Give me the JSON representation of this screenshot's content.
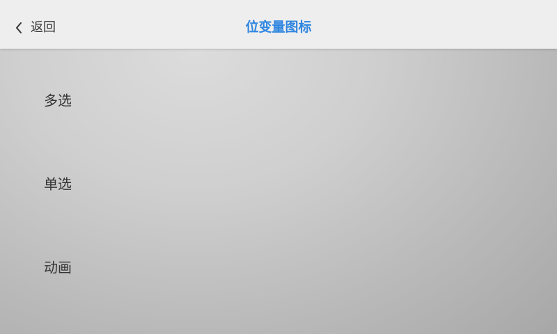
{
  "header": {
    "back_label": "返回",
    "back_icon": "chevron-left-icon",
    "title": "位变量图标",
    "title_color": "#2f86e0"
  },
  "menu": {
    "items": [
      {
        "label": "多选"
      },
      {
        "label": "单选"
      },
      {
        "label": "动画"
      }
    ]
  }
}
